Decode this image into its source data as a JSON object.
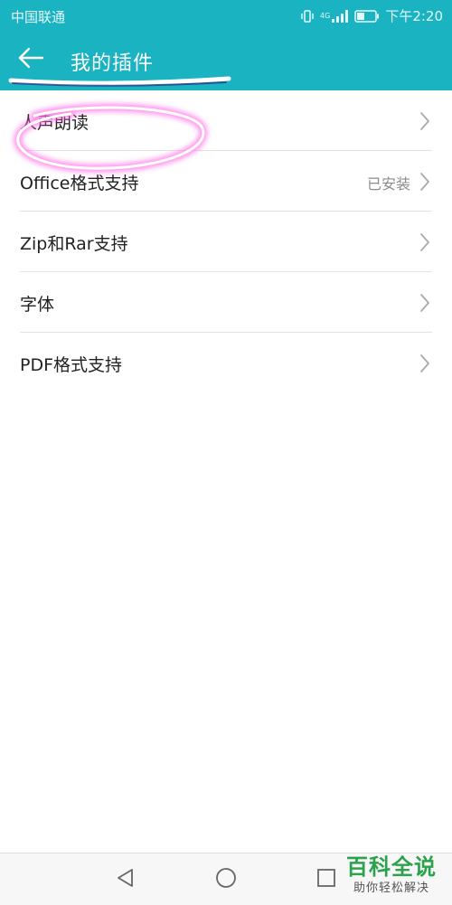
{
  "status_bar": {
    "carrier": "中国联通",
    "network_type": "4G",
    "time": "下午2:20",
    "icons": [
      "vibrate-icon",
      "signal-icon",
      "battery-icon"
    ]
  },
  "header": {
    "title": "我的插件",
    "back_icon": "arrow-left-icon",
    "background_color": "#1ab3c1"
  },
  "plugins": [
    {
      "label": "人声朗读",
      "status": ""
    },
    {
      "label": "Office格式支持",
      "status": "已安装"
    },
    {
      "label": "Zip和Rar支持",
      "status": ""
    },
    {
      "label": "字体",
      "status": ""
    },
    {
      "label": "PDF格式支持",
      "status": ""
    }
  ],
  "nav_bar": {
    "buttons": [
      "back-triangle-icon",
      "home-circle-icon",
      "recents-square-icon"
    ]
  },
  "watermark": {
    "main": "百科全说",
    "sub": "助你轻松解决"
  },
  "annotation_color": "#ff33dd"
}
